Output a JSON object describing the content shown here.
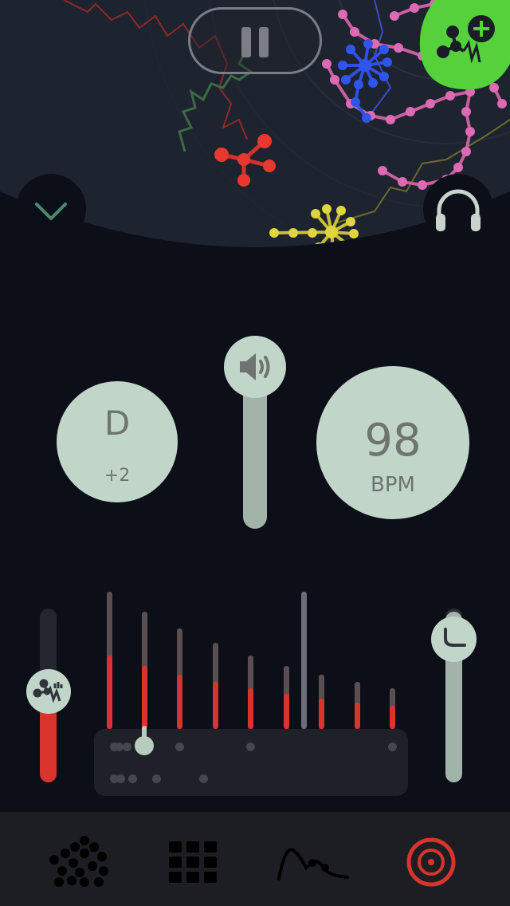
{
  "key": {
    "note": "D",
    "offset": "+2"
  },
  "tempo": {
    "value": "98",
    "unit": "BPM"
  },
  "volume": {
    "level": 0.85
  },
  "left_slider": {
    "level": 0.4
  },
  "right_slider": {
    "level": 0.98
  },
  "eq": {
    "levels": [
      0.54,
      0.53,
      0.53,
      0.55,
      0.55,
      0.55,
      0.55,
      0.55,
      0.55
    ],
    "active_index": 6
  },
  "tabs": [
    {
      "name": "molecules",
      "icon": "molecule-cluster-icon"
    },
    {
      "name": "grid",
      "icon": "grid-icon"
    },
    {
      "name": "curve",
      "icon": "curve-icon"
    },
    {
      "name": "record",
      "icon": "target-icon",
      "active": true
    }
  ],
  "colors": {
    "accent_red": "#d9342b",
    "knob": "#c1d6c9",
    "add_button": "#54d13b"
  }
}
